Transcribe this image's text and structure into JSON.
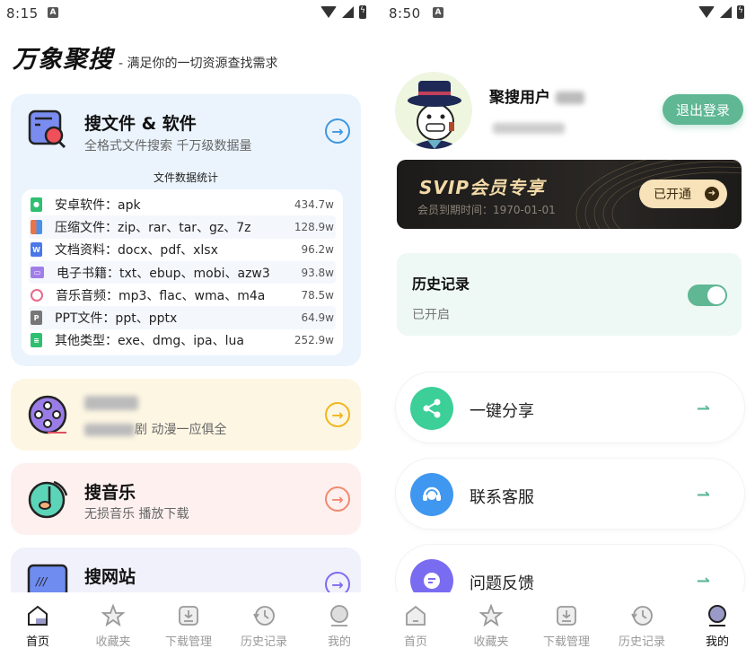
{
  "left": {
    "status": {
      "time": "8:15",
      "notif": "A"
    },
    "header": {
      "logo": "万象聚搜",
      "slogan": "- 满足你的一切资源查找需求"
    },
    "files_card": {
      "title": "搜文件 & 软件",
      "subtitle": "全格式文件搜索 千万级数据量",
      "stats_title": "文件数据统计",
      "stats": [
        {
          "label": "安卓软件：apk",
          "count": "434.7w",
          "icon": "apk-file-icon",
          "color": "#2fbf71"
        },
        {
          "label": "压缩文件：zip、rar、tar、gz、7z",
          "count": "128.9w",
          "icon": "archive-file-icon",
          "color": "#e8744a"
        },
        {
          "label": "文档资料：docx、pdf、xlsx",
          "count": "96.2w",
          "icon": "word-doc-icon",
          "color": "#4a78e8"
        },
        {
          "label": "电子书籍：txt、ebup、mobi、azw3",
          "count": "93.8w",
          "icon": "ebook-icon",
          "color": "#a07ee8"
        },
        {
          "label": "音乐音频：mp3、flac、wma、m4a",
          "count": "78.5w",
          "icon": "audio-file-icon",
          "color": "#e86a8a"
        },
        {
          "label": "PPT文件：ppt、pptx",
          "count": "64.9w",
          "icon": "ppt-file-icon",
          "color": "#777777"
        },
        {
          "label": "其他类型：exe、dmg、ipa、lua",
          "count": "252.9w",
          "icon": "other-file-icon",
          "color": "#2fbf71"
        }
      ]
    },
    "video_card": {
      "subtitle_visible": "剧 动漫一应俱全"
    },
    "music_card": {
      "title": "搜音乐",
      "subtitle": "无损音乐 播放下载"
    },
    "web_card": {
      "title": "搜网站"
    },
    "tabs": [
      {
        "label": "首页",
        "active": true
      },
      {
        "label": "收藏夹",
        "active": false
      },
      {
        "label": "下载管理",
        "active": false
      },
      {
        "label": "历史记录",
        "active": false
      },
      {
        "label": "我的",
        "active": false
      }
    ]
  },
  "right": {
    "status": {
      "time": "8:50",
      "notif": "A"
    },
    "profile": {
      "username": "聚搜用户",
      "logout_label": "退出登录"
    },
    "svip": {
      "title": "SVIP会员专享",
      "expiry": "会员到期时间：1970-01-01",
      "button_label": "已开通"
    },
    "history": {
      "title": "历史记录",
      "status": "已开启",
      "enabled": true
    },
    "menu": [
      {
        "label": "一键分享",
        "icon": "share-icon",
        "color": "#3ccf98"
      },
      {
        "label": "联系客服",
        "icon": "headset-icon",
        "color": "#3f97f0"
      },
      {
        "label": "问题反馈",
        "icon": "feedback-icon",
        "color": "#7a6cf0"
      }
    ],
    "tabs": [
      {
        "label": "首页",
        "active": false
      },
      {
        "label": "收藏夹",
        "active": false
      },
      {
        "label": "下载管理",
        "active": false
      },
      {
        "label": "历史记录",
        "active": false
      },
      {
        "label": "我的",
        "active": true
      }
    ]
  },
  "colors": {
    "accent_green": "#5fb794",
    "files_blue": "#3f97e0",
    "video_yellow": "#f2b51c",
    "music_red": "#f08a70",
    "web_purple": "#7a6cf0"
  }
}
